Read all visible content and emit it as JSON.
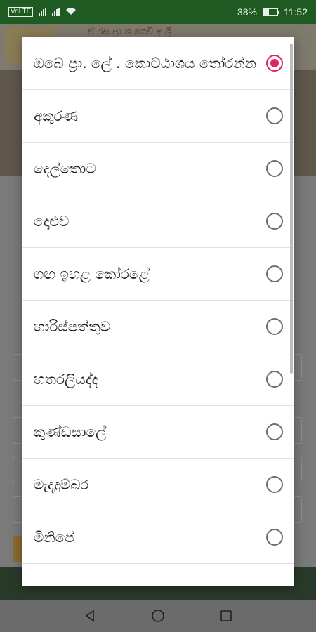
{
  "status_bar": {
    "network": "VoLTE",
    "battery": "38%",
    "time": "11:52",
    "battery_level": 0.38
  },
  "background": {
    "banner_text": "ඒ රස ප්‍රා ශ ගෙවි අ ශ්‍රි"
  },
  "dialog": {
    "options": [
      {
        "label": "ඔබේ ප්‍රා. ලේ . කොට්ඨාශය තෝරන්න",
        "checked": true
      },
      {
        "label": "අකුරණ",
        "checked": false
      },
      {
        "label": "දෙල්තොට",
        "checked": false
      },
      {
        "label": "දොළුව",
        "checked": false
      },
      {
        "label": "ගඟ ඉහළ කෝරළේ",
        "checked": false
      },
      {
        "label": "හාරිස්පත්තුව",
        "checked": false
      },
      {
        "label": "හතරලියද්ද",
        "checked": false
      },
      {
        "label": "කුණ්ඩසාලේ",
        "checked": false
      },
      {
        "label": "මැදදුම්බර",
        "checked": false
      },
      {
        "label": "මිනිපේ",
        "checked": false
      }
    ]
  },
  "colors": {
    "accent": "#e0245e",
    "status_bar": "#1f5a23"
  }
}
